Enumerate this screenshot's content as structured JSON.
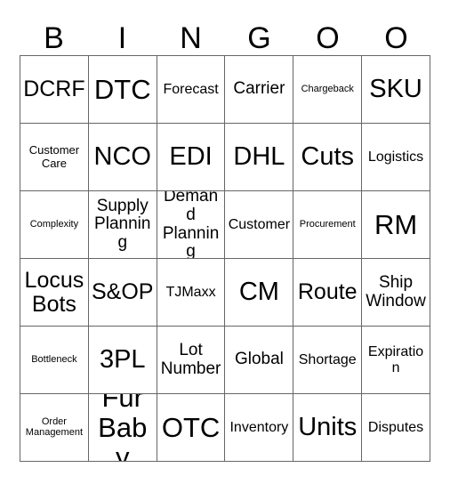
{
  "card": {
    "title_letters": [
      "B",
      "I",
      "N",
      "G",
      "O",
      "O"
    ],
    "columns": 6,
    "rows": 6,
    "colors": {
      "border": "#666666",
      "text": "#000000",
      "background": "#ffffff"
    },
    "cells": [
      [
        {
          "label": "DCRF",
          "size": "lg"
        },
        {
          "label": "DTC",
          "size": "xxl"
        },
        {
          "label": "Forecast",
          "size": "sm"
        },
        {
          "label": "Carrier",
          "size": "md"
        },
        {
          "label": "Chargeback",
          "size": "xxs"
        },
        {
          "label": "SKU",
          "size": "xl"
        }
      ],
      [
        {
          "label": "Customer Care",
          "size": "xs"
        },
        {
          "label": "NCO",
          "size": "xl"
        },
        {
          "label": "EDI",
          "size": "xl"
        },
        {
          "label": "DHL",
          "size": "xl"
        },
        {
          "label": "Cuts",
          "size": "xl"
        },
        {
          "label": "Logistics",
          "size": "sm"
        }
      ],
      [
        {
          "label": "Complexity",
          "size": "xxs"
        },
        {
          "label": "Supply Planning",
          "size": "md"
        },
        {
          "label": "Demand Planning",
          "size": "md"
        },
        {
          "label": "Customer",
          "size": "sm"
        },
        {
          "label": "Procurement",
          "size": "xxs"
        },
        {
          "label": "RM",
          "size": "xxl"
        }
      ],
      [
        {
          "label": "Locus Bots",
          "size": "lg"
        },
        {
          "label": "S&OP",
          "size": "lg"
        },
        {
          "label": "TJMaxx",
          "size": "sm"
        },
        {
          "label": "CM",
          "size": "xl"
        },
        {
          "label": "Route",
          "size": "lg"
        },
        {
          "label": "Ship Window",
          "size": "md"
        }
      ],
      [
        {
          "label": "Bottleneck",
          "size": "xxs"
        },
        {
          "label": "3PL",
          "size": "xl"
        },
        {
          "label": "Lot Number",
          "size": "md"
        },
        {
          "label": "Global",
          "size": "md"
        },
        {
          "label": "Shortage",
          "size": "sm"
        },
        {
          "label": "Expiration",
          "size": "sm"
        }
      ],
      [
        {
          "label": "Order Management",
          "size": "xxs"
        },
        {
          "label": "Fur Baby",
          "size": "xxl"
        },
        {
          "label": "OTC",
          "size": "xxl"
        },
        {
          "label": "Inventory",
          "size": "sm"
        },
        {
          "label": "Units",
          "size": "xl"
        },
        {
          "label": "Disputes",
          "size": "sm"
        }
      ]
    ]
  }
}
